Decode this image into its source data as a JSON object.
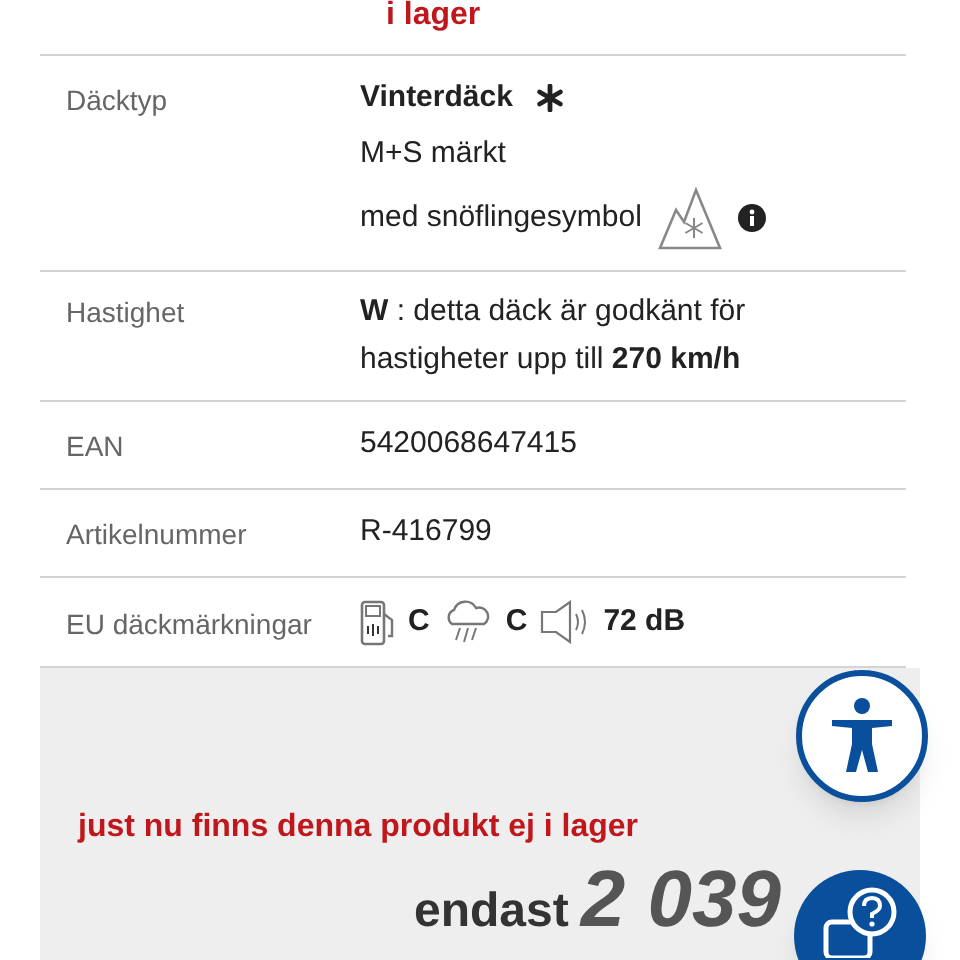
{
  "stock_top": {
    "text": "i lager"
  },
  "specs": [
    {
      "kind": "tire_type",
      "label": "Däcktyp",
      "title": "Vinterdäck",
      "lines": [
        "M+S märkt",
        "med snöflingesymbol"
      ]
    },
    {
      "kind": "rich",
      "label": "Hastighet",
      "text": "**W** : detta däck är godkänt för hastigheter upp till **270 km/h**"
    },
    {
      "kind": "plain",
      "label": "EAN",
      "text": "5420068647415"
    },
    {
      "kind": "plain",
      "label": "Artikelnummer",
      "text": "R-416799"
    },
    {
      "kind": "eu_label",
      "label": "EU däckmärkningar",
      "fuel": "C",
      "wet": "C",
      "noise": "72 dB"
    }
  ],
  "purchase": {
    "stock_message": "just nu finns denna produkt ej i lager",
    "price_prefix": "endast",
    "price": "2 039"
  }
}
